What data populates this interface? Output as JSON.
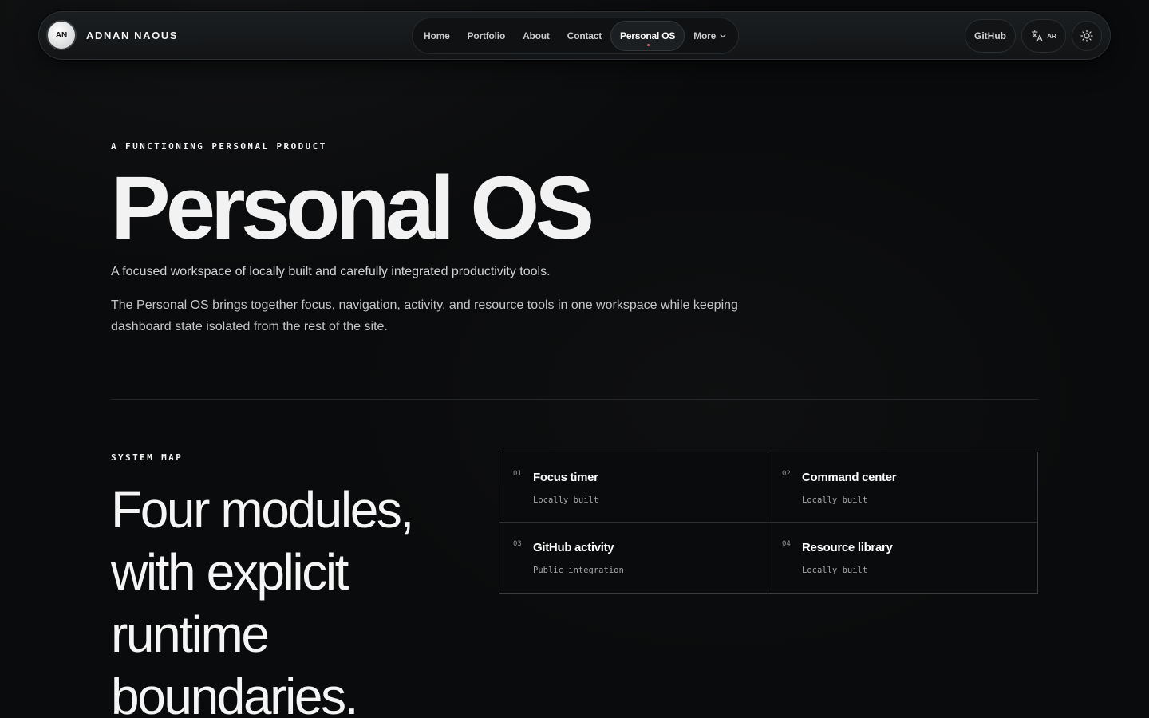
{
  "header": {
    "avatar_initials": "AN",
    "brand_name": "ADNAN NAOUS",
    "nav": [
      {
        "label": "Home"
      },
      {
        "label": "Portfolio"
      },
      {
        "label": "About"
      },
      {
        "label": "Contact"
      },
      {
        "label": "Personal OS",
        "active": true
      },
      {
        "label": "More"
      }
    ],
    "github_label": "GitHub",
    "lang_label": "AR",
    "icons": {
      "language": "translate-icon",
      "theme": "sun-icon",
      "more": "chevron-down-icon"
    },
    "active_indicator_color": "#e35a5a"
  },
  "hero": {
    "eyebrow": "A FUNCTIONING PERSONAL PRODUCT",
    "title": "Personal OS",
    "lead": "A focused workspace of locally built and carefully integrated productivity tools.",
    "body": "The Personal OS brings together focus, navigation, activity, and resource tools in one workspace while keeping dashboard state isolated from the rest of the site."
  },
  "system_map": {
    "eyebrow": "SYSTEM MAP",
    "title": "Four modules, with explicit runtime boundaries.",
    "modules": [
      {
        "num": "01",
        "title": "Focus timer",
        "sub": "Locally built"
      },
      {
        "num": "02",
        "title": "Command center",
        "sub": "Locally built"
      },
      {
        "num": "03",
        "title": "GitHub activity",
        "sub": "Public integration"
      },
      {
        "num": "04",
        "title": "Resource library",
        "sub": "Locally built"
      }
    ]
  }
}
